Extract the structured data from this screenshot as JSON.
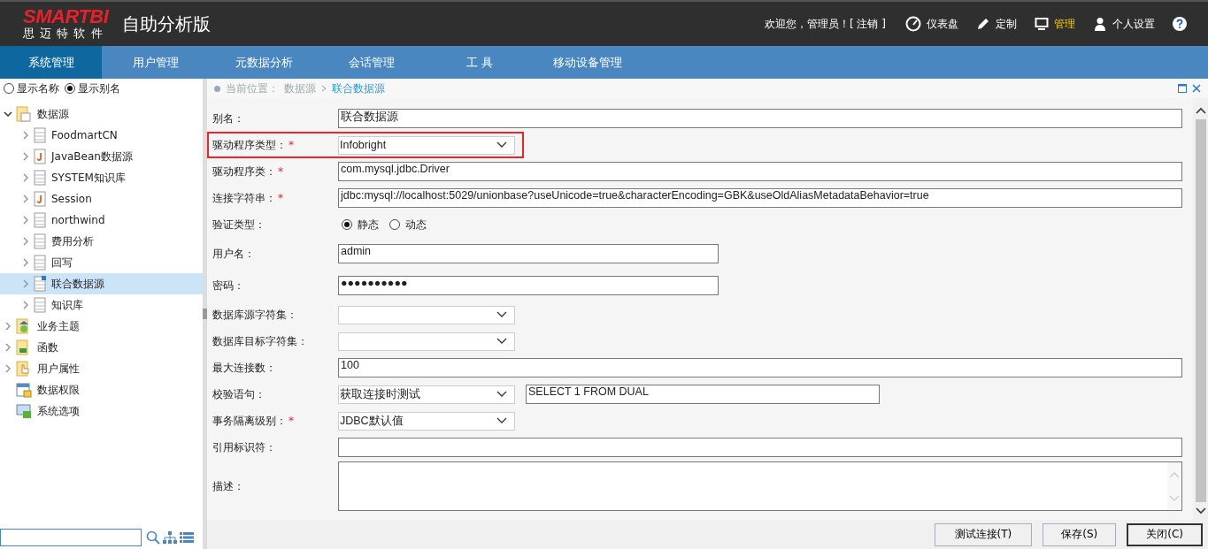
{
  "header": {
    "logo": {
      "brand": "SMARTBI",
      "sub": "思 迈 特 软 件"
    },
    "app_title": "自助分析版",
    "welcome": "欢迎您，管理员！[ 注销 ]",
    "links": [
      {
        "label": "仪表盘",
        "kind": "gauge",
        "selected": false
      },
      {
        "label": "定制",
        "kind": "pencil",
        "selected": false
      },
      {
        "label": "管理",
        "kind": "monitor",
        "selected": true
      },
      {
        "label": "个人设置",
        "kind": "person",
        "selected": false
      }
    ]
  },
  "nav": [
    {
      "label": "系统管理",
      "selected": true
    },
    {
      "label": "用户管理",
      "selected": false
    },
    {
      "label": "元数据分析",
      "selected": false
    },
    {
      "label": "会话管理",
      "selected": false
    },
    {
      "label": "工 具",
      "selected": false
    },
    {
      "label": "移动设备管理",
      "selected": false
    }
  ],
  "sidebar": {
    "display_options": [
      {
        "label": "显示名称",
        "selected": false
      },
      {
        "label": "显示别名",
        "selected": true
      }
    ],
    "tree": [
      {
        "label": "数据源",
        "kind": "folder-db",
        "expanded": true,
        "selected": false,
        "children": [
          {
            "label": "FoodmartCN",
            "kind": "db",
            "expanded": false,
            "selected": false
          },
          {
            "label": "JavaBean数据源",
            "kind": "java",
            "expanded": false,
            "selected": false
          },
          {
            "label": "SYSTEM知识库",
            "kind": "db",
            "expanded": false,
            "selected": false
          },
          {
            "label": "Session",
            "kind": "java",
            "expanded": false,
            "selected": false
          },
          {
            "label": "northwind",
            "kind": "db",
            "expanded": false,
            "selected": false
          },
          {
            "label": "费用分析",
            "kind": "db",
            "expanded": false,
            "selected": false
          },
          {
            "label": "回写",
            "kind": "db",
            "expanded": false,
            "selected": false
          },
          {
            "label": "联合数据源",
            "kind": "db-union",
            "expanded": false,
            "selected": true
          },
          {
            "label": "知识库",
            "kind": "db",
            "expanded": false,
            "selected": false
          }
        ]
      },
      {
        "label": "业务主题",
        "kind": "folder-topic",
        "expanded": false,
        "selected": false
      },
      {
        "label": "函数",
        "kind": "folder-fx",
        "expanded": false,
        "selected": false
      },
      {
        "label": "用户属性",
        "kind": "folder-hand",
        "expanded": false,
        "selected": false
      },
      {
        "label": "数据权限",
        "kind": "permission",
        "selected": false
      },
      {
        "label": "系统选项",
        "kind": "options",
        "selected": false
      }
    ]
  },
  "breadcrumb": {
    "label": "当前位置：",
    "path": [
      {
        "label": "数据源",
        "current": false
      },
      {
        "label": "联合数据源",
        "current": true
      }
    ]
  },
  "form": [
    {
      "label": "别名：",
      "kind": "text",
      "wide": true,
      "value": "联合数据源",
      "highlighted": false
    },
    {
      "label": "驱动程序类型：",
      "required_mark": "*",
      "kind": "select",
      "value": "Infobright",
      "highlighted": true
    },
    {
      "label": "驱动程序类：",
      "required_mark": "*",
      "kind": "text",
      "wide": true,
      "value": "com.mysql.jdbc.Driver",
      "highlighted": false
    },
    {
      "label": "连接字符串：",
      "required_mark": "*",
      "kind": "text",
      "wide": true,
      "value": "jdbc:mysql://localhost:5029/unionbase?useUnicode=true&characterEncoding=GBK&useOldAliasMetadataBehavior=true",
      "highlighted": false
    },
    {
      "label": "验证类型：",
      "kind": "radio",
      "options": [
        {
          "label": "静态",
          "selected": true
        },
        {
          "label": "动态",
          "selected": false
        }
      ],
      "highlighted": false
    },
    {
      "label": "用户名：",
      "kind": "text",
      "wide": false,
      "value": "admin",
      "highlighted": false
    },
    {
      "label": "密码：",
      "kind": "password",
      "wide": false,
      "value": "●●●●●●●●●●",
      "highlighted": false
    },
    {
      "label": "数据库源字符集：",
      "kind": "select",
      "highlighted": false
    },
    {
      "label": "数据库目标字符集：",
      "kind": "select",
      "highlighted": false
    },
    {
      "label": "最大连接数：",
      "kind": "text",
      "wide": true,
      "value": "100",
      "highlighted": false
    },
    {
      "label": "校验语句：",
      "kind": "select-text",
      "value": "获取连接时测试",
      "text": "SELECT 1 FROM DUAL",
      "highlighted": false
    },
    {
      "label": "事务隔离级别：",
      "required_mark": "*",
      "kind": "select",
      "value": "JDBC默认值",
      "highlighted": false
    },
    {
      "label": "引用标识符：",
      "kind": "text",
      "wide": true,
      "highlighted": false
    },
    {
      "label": "描述：",
      "kind": "textarea",
      "highlighted": false
    }
  ],
  "buttons": [
    {
      "label": "测试连接(T)",
      "focused": false
    },
    {
      "label": "保存(S)",
      "focused": false
    },
    {
      "label": "关闭(C)",
      "focused": true
    }
  ]
}
